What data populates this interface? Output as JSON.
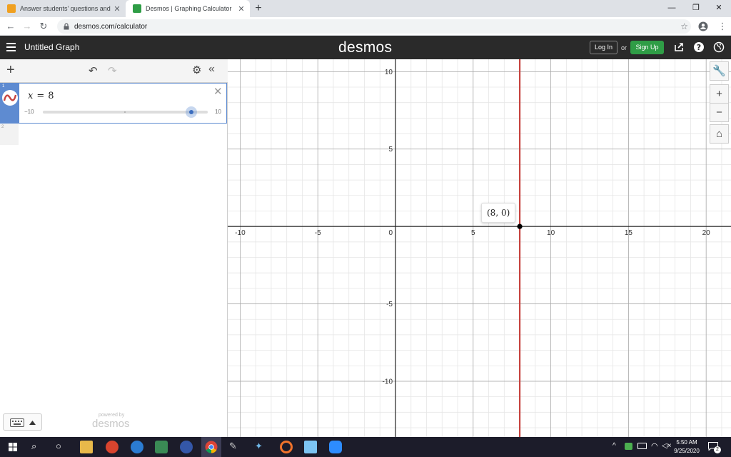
{
  "browser": {
    "tabs": [
      {
        "title": "Answer students' questions and …",
        "active": false
      },
      {
        "title": "Desmos | Graphing Calculator",
        "active": true
      }
    ],
    "url": "desmos.com/calculator"
  },
  "header": {
    "graph_title": "Untitled Graph",
    "logo": "desmos",
    "login_label": "Log In",
    "or_label": "or",
    "signup_label": "Sign Up"
  },
  "expressions": [
    {
      "index": "1",
      "variable": "x",
      "operator": "=",
      "value": "8",
      "slider": {
        "min": "−10",
        "max": "10",
        "min_value": -10,
        "max_value": 10,
        "current": 8
      }
    },
    {
      "index": "2"
    }
  ],
  "footer": {
    "powered_by": "powered by",
    "logo": "desmos"
  },
  "graph": {
    "x_ticks": [
      "-10",
      "-5",
      "0",
      "5",
      "10",
      "15",
      "20"
    ],
    "y_ticks": [
      "10",
      "5",
      "-5",
      "-10"
    ],
    "point_label": "(8, 0)",
    "line_color": "#c74440",
    "x_range": [
      -10.8,
      21.6
    ],
    "y_range": [
      -13.6,
      10.8
    ]
  },
  "chart_data": {
    "type": "line",
    "x": [
      8,
      8
    ],
    "y": [
      -13.6,
      10.8
    ],
    "xlim": [
      -10.8,
      21.6
    ],
    "ylim": [
      -13.6,
      10.8
    ],
    "grid": true,
    "points": [
      {
        "x": 8,
        "y": 0,
        "label": "(8, 0)"
      }
    ]
  },
  "taskbar": {
    "time": "5:50 AM",
    "date": "9/25/2020",
    "notifications": "2"
  }
}
